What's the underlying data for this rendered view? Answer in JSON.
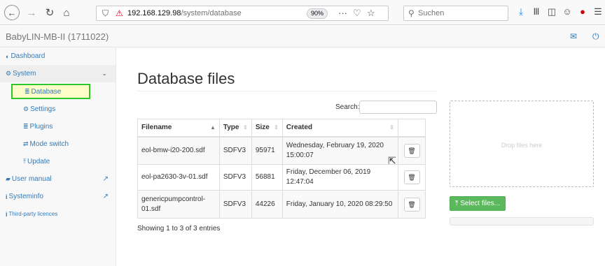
{
  "browser": {
    "url_host": "192.168.129.98",
    "url_path": "/system/database",
    "zoom": "90%",
    "search_placeholder": "Suchen",
    "icons": {
      "back": "←",
      "forward": "→",
      "reload": "↻",
      "home": "⌂",
      "shield": "⛉",
      "lock": "⚠",
      "more": "···",
      "pocket": "♡",
      "star": "☆",
      "search": "🔍",
      "download": "⤓",
      "library": "Ⅲ",
      "sidebar": "◫",
      "account": "☺",
      "ublock": "●",
      "menu": "☰"
    }
  },
  "app": {
    "brand": "BabyLIN-MB-II (1711022)",
    "mail_icon": "✉",
    "power_icon": "⏻"
  },
  "sidebar": {
    "dashboard": "Dashboard",
    "system": "System",
    "database": "Database",
    "settings": "Settings",
    "plugins": "Plugins",
    "mode_switch": "Mode switch",
    "update": "Update",
    "user_manual": "User manual",
    "systeminfo": "Systeminfo",
    "third_party": "Third-party licences",
    "icons": {
      "dashboard": "◐",
      "system": "⚙",
      "database": "≣",
      "settings": "⚙",
      "plugins": "≣",
      "mode_switch": "⇄",
      "update": "⤒",
      "user_manual": "▰",
      "systeminfo": "i",
      "third_party": "i",
      "external": "↗",
      "chevron": "⌄"
    }
  },
  "main": {
    "title": "Database files",
    "search_label": "Search:",
    "search_value": "",
    "columns": [
      "Filename",
      "Type",
      "Size",
      "Created"
    ],
    "rows": [
      {
        "filename": "eol-bmw-i20-200.sdf",
        "type": "SDFV3",
        "size": "95971",
        "created": "Wednesday, February 19, 2020 15:00:07"
      },
      {
        "filename": "eol-pa2630-3v-01.sdf",
        "type": "SDFV3",
        "size": "56881",
        "created": "Friday, December 06, 2019 12:47:04"
      },
      {
        "filename": "genericpumpcontrol-01.sdf",
        "type": "SDFV3",
        "size": "44226",
        "created": "Friday, January 10, 2020 08:29:50"
      }
    ],
    "info": "Showing 1 to 3 of 3 entries",
    "drop_text": "Drop files here",
    "select_button": "Select files...",
    "select_icon": "⤒",
    "trash_icon": "🗑",
    "progress_value": 0
  }
}
